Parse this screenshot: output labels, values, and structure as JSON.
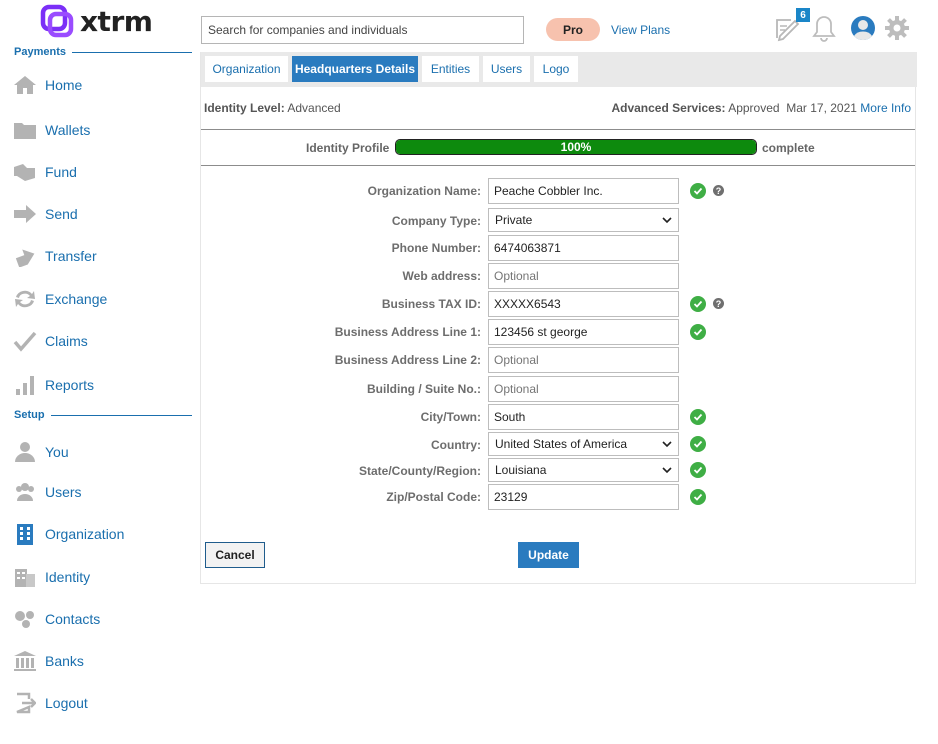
{
  "app": {
    "name": "xtrm"
  },
  "header": {
    "search_placeholder": "Search for companies and individuals",
    "pro_label": "Pro",
    "view_plans_label": "View Plans",
    "notification_badge": "6"
  },
  "sidebar": {
    "payments_heading": "Payments",
    "setup_heading": "Setup",
    "payments_items": [
      {
        "label": "Home",
        "icon": "home-icon"
      },
      {
        "label": "Wallets",
        "icon": "folder-icon"
      },
      {
        "label": "Fund",
        "icon": "fund-icon"
      },
      {
        "label": "Send",
        "icon": "arrow-right-icon"
      },
      {
        "label": "Transfer",
        "icon": "transfer-icon"
      },
      {
        "label": "Exchange",
        "icon": "exchange-icon"
      },
      {
        "label": "Claims",
        "icon": "check-icon"
      },
      {
        "label": "Reports",
        "icon": "bar-chart-icon"
      }
    ],
    "setup_items": [
      {
        "label": "You",
        "icon": "user-icon"
      },
      {
        "label": "Users",
        "icon": "users-icon"
      },
      {
        "label": "Organization",
        "icon": "building-icon"
      },
      {
        "label": "Identity",
        "icon": "identity-icon"
      },
      {
        "label": "Contacts",
        "icon": "contacts-icon"
      },
      {
        "label": "Banks",
        "icon": "bank-icon"
      },
      {
        "label": "Logout",
        "icon": "logout-icon"
      }
    ]
  },
  "tabs": [
    {
      "label": "Organization",
      "active": false
    },
    {
      "label": "Headquarters Details",
      "active": true
    },
    {
      "label": "Entities",
      "active": false
    },
    {
      "label": "Users",
      "active": false
    },
    {
      "label": "Logo",
      "active": false
    }
  ],
  "identity": {
    "level_label": "Identity Level:",
    "level_value": "Advanced",
    "services_label": "Advanced Services:",
    "services_value": "Approved",
    "services_date": "Mar 17, 2021",
    "more_info_label": "More Info"
  },
  "profile": {
    "label": "Identity Profile",
    "percent": 100,
    "percent_text": "100%",
    "after_label": "complete"
  },
  "form": {
    "fields": [
      {
        "label": "Organization Name:",
        "value": "Peache Cobbler Inc.",
        "placeholder": "",
        "type": "text",
        "verified": true,
        "help": true
      },
      {
        "label": "Company Type:",
        "value": "Private",
        "placeholder": "",
        "type": "select",
        "verified": false,
        "help": false
      },
      {
        "label": "Phone Number:",
        "value": "6474063871",
        "placeholder": "",
        "type": "text",
        "verified": false,
        "help": false
      },
      {
        "label": "Web address:",
        "value": "",
        "placeholder": "Optional",
        "type": "text",
        "verified": false,
        "help": false
      },
      {
        "label": "Business TAX ID:",
        "value": "XXXXX6543",
        "placeholder": "",
        "type": "text",
        "verified": true,
        "help": true
      },
      {
        "label": "Business Address Line 1:",
        "value": "123456 st george",
        "placeholder": "",
        "type": "text",
        "verified": true,
        "help": false
      },
      {
        "label": "Business Address Line 2:",
        "value": "",
        "placeholder": "Optional",
        "type": "text",
        "verified": false,
        "help": false
      },
      {
        "label": "Building / Suite No.:",
        "value": "",
        "placeholder": "Optional",
        "type": "text",
        "verified": false,
        "help": false
      },
      {
        "label": "City/Town:",
        "value": "South",
        "placeholder": "",
        "type": "text",
        "verified": true,
        "help": false
      },
      {
        "label": "Country:",
        "value": "United States of America",
        "placeholder": "",
        "type": "select",
        "verified": true,
        "help": false
      },
      {
        "label": "State/County/Region:",
        "value": "Louisiana",
        "placeholder": "",
        "type": "select",
        "verified": true,
        "help": false
      },
      {
        "label": "Zip/Postal Code:",
        "value": "23129",
        "placeholder": "",
        "type": "text",
        "verified": true,
        "help": false
      }
    ],
    "help_glyph": "?",
    "cancel_label": "Cancel",
    "update_label": "Update"
  },
  "colors": {
    "brand_purple": "#7b2ff7",
    "link_blue": "#1a6fae",
    "tab_active": "#2a7bbf",
    "progress_green": "#0d8a0d",
    "check_green": "#3fae45",
    "pro_badge": "#f7c2ae"
  }
}
